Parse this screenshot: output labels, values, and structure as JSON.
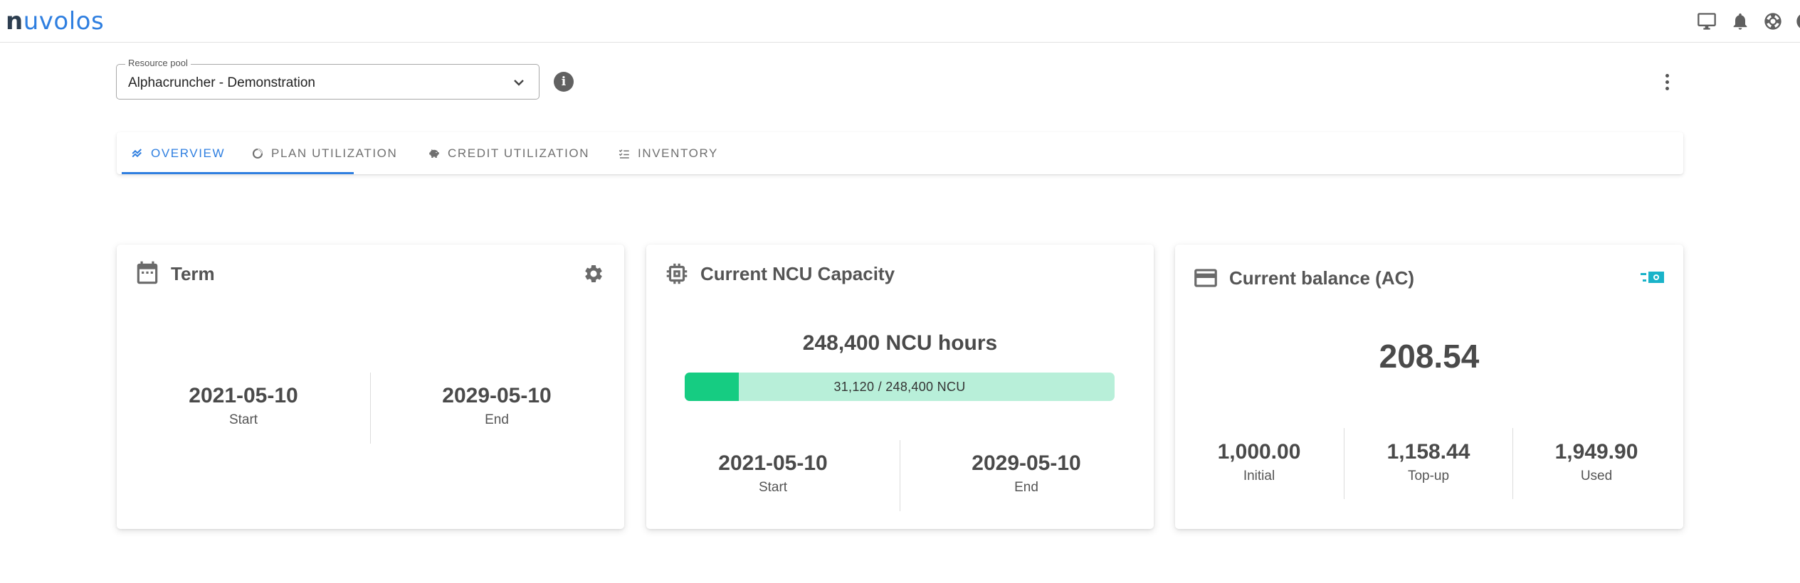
{
  "app": {
    "logo_n": "n",
    "logo_rest": "uvolos"
  },
  "topbar": {
    "icons": [
      "monitor-icon",
      "bell-icon",
      "lifebuoy-icon",
      "account-circle-icon"
    ]
  },
  "resource_pool": {
    "label": "Resource pool",
    "value": "Alphacruncher - Demonstration"
  },
  "tabs": [
    {
      "label": "OVERVIEW",
      "icon": "chart-line-icon",
      "active": true
    },
    {
      "label": "PLAN UTILIZATION",
      "icon": "donut-icon",
      "active": false
    },
    {
      "label": "CREDIT UTILIZATION",
      "icon": "piggy-bank-icon",
      "active": false
    },
    {
      "label": "INVENTORY",
      "icon": "checklist-icon",
      "active": false
    }
  ],
  "term": {
    "title": "Term",
    "start_value": "2021-05-10",
    "start_label": "Start",
    "end_value": "2029-05-10",
    "end_label": "End"
  },
  "capacity": {
    "title": "Current NCU Capacity",
    "total": "248,400 NCU hours",
    "progress_text": "31,120 / 248,400 NCU",
    "used": 31120,
    "capacity": 248400,
    "start_value": "2021-05-10",
    "start_label": "Start",
    "end_value": "2029-05-10",
    "end_label": "End"
  },
  "balance": {
    "title": "Current balance (AC)",
    "amount": "208.54",
    "initial_value": "1,000.00",
    "initial_label": "Initial",
    "topup_value": "1,158.44",
    "topup_label": "Top-up",
    "used_value": "1,949.90",
    "used_label": "Used"
  },
  "colors": {
    "accent": "#2f7fe0",
    "progress_fill": "#16cc82",
    "progress_track": "#b8efd9",
    "cash_icon": "#1ab3c9"
  }
}
